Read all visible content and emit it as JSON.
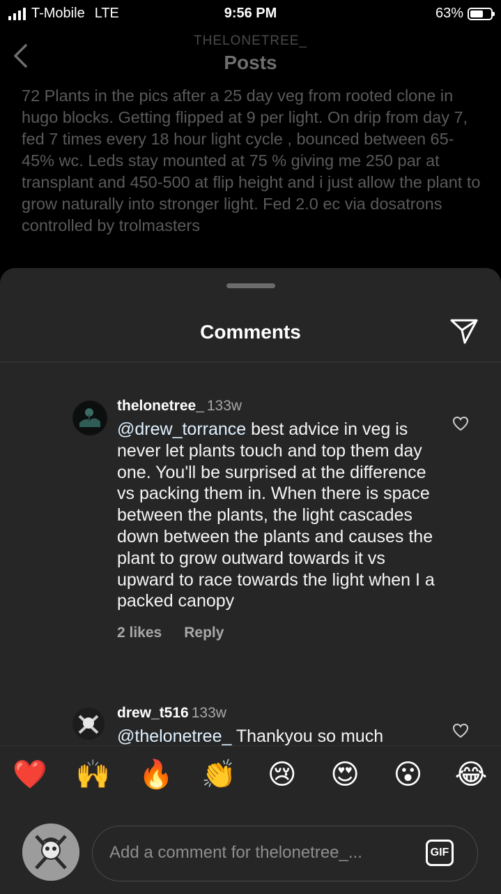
{
  "status_bar": {
    "carrier": "T-Mobile",
    "network": "LTE",
    "time": "9:56 PM",
    "battery": "63%",
    "battery_level": 0.63
  },
  "post_header": {
    "username": "THELONETREE_",
    "title": "Posts"
  },
  "post_caption": "72 Plants in the pics after a 25 day veg from rooted clone in hugo blocks.  Getting flipped at 9 per light. On drip from day 7, fed 7 times every 18 hour light cycle , bounced between 65-45% wc. Leds stay mounted at 75 % giving me 250 par at transplant and 450-500 at flip height and i just allow the plant to grow naturally into stronger light.  Fed 2.0 ec via dosatrons controlled by trolmasters",
  "comments_sheet": {
    "title": "Comments",
    "comments": [
      {
        "username": "thelonetree_",
        "time": "133w",
        "mention": "@drew_torrance",
        "text": " best advice in veg is never let plants touch and top them day one. You'll be surprised at the difference vs packing them in. When there is space between the plants,  the light cascades down between the plants and causes the plant to grow outward towards it vs upward to race towards the light when I a packed canopy",
        "likes": "2 likes",
        "reply": "Reply"
      },
      {
        "username": "drew_t516",
        "time": "133w",
        "mention": "@thelonetree_",
        "text": " Thankyou so much"
      }
    ]
  },
  "quick_reactions": [
    "❤️",
    "🙌",
    "🔥",
    "👏",
    "😢",
    "😍",
    "😮",
    "😂"
  ],
  "comment_input": {
    "placeholder": "Add a comment for thelonetree_...",
    "gif_label": "GIF"
  }
}
